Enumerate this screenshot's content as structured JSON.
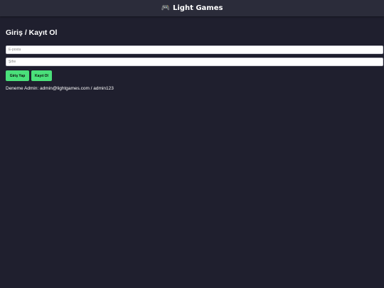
{
  "header": {
    "icon": "gamepad-icon",
    "title": "Light Games"
  },
  "main": {
    "title": "Giriş / Kayıt Ol",
    "email": {
      "value": "",
      "placeholder": "E-posta"
    },
    "password": {
      "value": "",
      "placeholder": "Şifre"
    },
    "login_button": "Giriş Yap",
    "register_button": "Kayıt Ol",
    "demo_text": "Deneme Admin: admin@lightgames.com / admin123"
  },
  "colors": {
    "background": "#1f1f2e",
    "header_background": "#2b2c3a",
    "button": "#4ae07a"
  }
}
